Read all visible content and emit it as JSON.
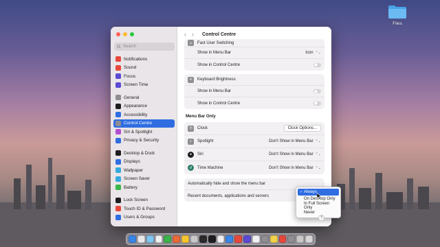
{
  "desktop": {
    "files_label": "Files"
  },
  "window": {
    "title": "Control Centre"
  },
  "sidebar": {
    "search_placeholder": "Search",
    "groups": [
      [
        {
          "label": "Notifications",
          "icon": "bell-icon",
          "color": "#e8473c"
        },
        {
          "label": "Sound",
          "icon": "speaker-icon",
          "color": "#e8473c"
        },
        {
          "label": "Focus",
          "icon": "moon-icon",
          "color": "#5b4ad3"
        },
        {
          "label": "Screen Time",
          "icon": "hourglass-icon",
          "color": "#5b4ad3"
        }
      ],
      [
        {
          "label": "General",
          "icon": "gear-icon",
          "color": "#8e8e93"
        },
        {
          "label": "Appearance",
          "icon": "appearance-icon",
          "color": "#1d1d1f"
        },
        {
          "label": "Accessibility",
          "icon": "accessibility-icon",
          "color": "#2f6de1"
        },
        {
          "label": "Control Centre",
          "icon": "control-centre-icon",
          "color": "#8e8e93",
          "selected": true
        },
        {
          "label": "Siri & Spotlight",
          "icon": "siri-icon",
          "color": "#b34fd1"
        },
        {
          "label": "Privacy & Security",
          "icon": "hand-icon",
          "color": "#2f6de1"
        }
      ],
      [
        {
          "label": "Desktop & Dock",
          "icon": "dock-icon",
          "color": "#1d1d1f"
        },
        {
          "label": "Displays",
          "icon": "display-icon",
          "color": "#2f6de1"
        },
        {
          "label": "Wallpaper",
          "icon": "wallpaper-icon",
          "color": "#36a9e0"
        },
        {
          "label": "Screen Saver",
          "icon": "screensaver-icon",
          "color": "#36a9e0"
        },
        {
          "label": "Battery",
          "icon": "battery-icon",
          "color": "#3bb54a"
        }
      ],
      [
        {
          "label": "Lock Screen",
          "icon": "lock-icon",
          "color": "#1d1d1f"
        },
        {
          "label": "Touch ID & Password",
          "icon": "fingerprint-icon",
          "color": "#e8473c"
        },
        {
          "label": "Users & Groups",
          "icon": "users-icon",
          "color": "#2f6de1"
        }
      ]
    ]
  },
  "fast_user": {
    "header": "Fast User Switching",
    "menu_bar_label": "Show in Menu Bar",
    "menu_bar_value": "Icon",
    "control_centre_label": "Show in Control Centre"
  },
  "keyboard": {
    "header": "Keyboard Brightness",
    "menu_bar_label": "Show in Menu Bar",
    "control_centre_label": "Show in Control Centre"
  },
  "menu_bar_only": {
    "section_title": "Menu Bar Only",
    "clock_label": "Clock",
    "clock_button": "Clock Options...",
    "spotlight_label": "Spotlight",
    "spotlight_value": "Don't Show in Menu Bar",
    "siri_label": "Siri",
    "siri_value": "Don't Show in Menu Bar",
    "time_machine_label": "Time Machine",
    "time_machine_value": "Don't Show in Menu Bar"
  },
  "auto_hide": {
    "label": "Automatically hide and show the menu bar"
  },
  "recent": {
    "label": "Recent documents, applications and servers"
  },
  "dropdown": {
    "options": [
      "Always",
      "On Desktop Only",
      "In Full Screen Only",
      "Never"
    ],
    "selected": "Always"
  },
  "help_label": "?",
  "colors": {
    "accent": "#2f6de1",
    "close": "#fe5f57",
    "minimize": "#febc2e",
    "zoom": "#28c840"
  }
}
